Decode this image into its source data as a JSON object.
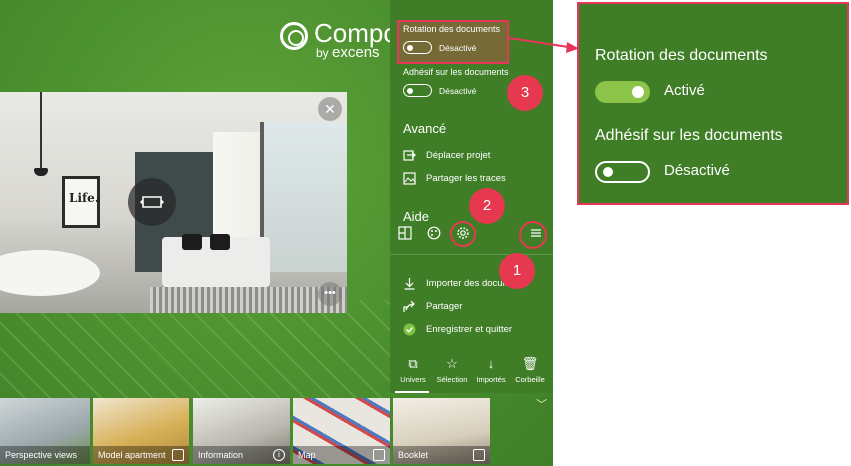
{
  "app": {
    "logo_title": "Compos",
    "logo_by": "by",
    "logo_brand": "excens",
    "room_poster_text": "Life."
  },
  "menu": {
    "rotation_label": "Rotation des documents",
    "rotation_state": "Désactivé",
    "adhesif_label": "Adhésif sur les documents",
    "adhesif_state": "Désactivé",
    "section_advanced": "Avancé",
    "move_project": "Déplacer projet",
    "share_traces": "Partager les traces",
    "section_help": "Aide",
    "import_docs": "Importer des documents",
    "share": "Partager",
    "save_quit": "Enregistrer et quitter",
    "tabs": [
      {
        "label": "Univers",
        "icon": "layers-icon"
      },
      {
        "label": "Sélection",
        "icon": "star-list-icon"
      },
      {
        "label": "Importés",
        "icon": "download-icon"
      },
      {
        "label": "Corbeille",
        "icon": "trash-icon"
      }
    ]
  },
  "thumbnails": [
    {
      "label": "Perspective views"
    },
    {
      "label": "Model apartment"
    },
    {
      "label": "Information"
    },
    {
      "label": "Map"
    },
    {
      "label": "Booklet"
    }
  ],
  "markers": {
    "m1": "1",
    "m2": "2",
    "m3": "3"
  },
  "callout": {
    "rotation_label": "Rotation des documents",
    "rotation_state": "Activé",
    "adhesif_label": "Adhésif sur les documents",
    "adhesif_state": "Désactivé"
  },
  "colors": {
    "app_green": "#4d9230",
    "menu_green": "#3f7e26",
    "highlight_red": "#e8365a",
    "toggle_on": "#8cc44a"
  }
}
